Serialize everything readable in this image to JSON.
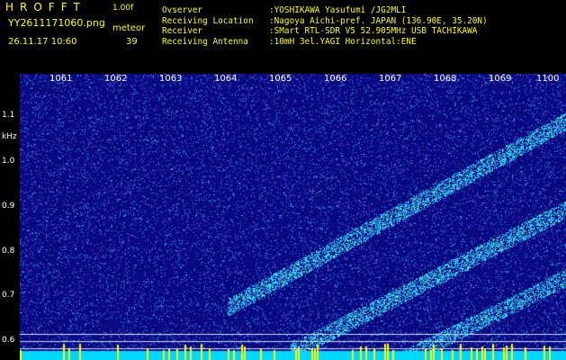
{
  "header": {
    "app_name": "HROFFT",
    "version": "1.00f",
    "filename": "YY2611171060.png",
    "datetime": "26.11.17 10:60",
    "meteor_label": "meteor",
    "meteor_count": "39"
  },
  "station": [
    {
      "key": "Ovserver",
      "value": ":YOSHIKAWA Yasufumi /JG2MLI"
    },
    {
      "key": "Receiving Location",
      "value": ":Nagoya Aichi-pref. JAPAN (136.90E, 35.20N)"
    },
    {
      "key": "Receiver",
      "value": ":SMart RTL-SDR V5 52.905MHz USB TACHIKAWA"
    },
    {
      "key": "Receiving Antenna",
      "value": ":10mH 3el.YAGI Horizontal:ENE"
    }
  ],
  "axes": {
    "y_unit": "kHz",
    "y_ticks": [
      "1.1",
      "1.0",
      "0.9",
      "0.8",
      "0.7",
      "0.6"
    ],
    "x_ticks": [
      "1061",
      "1062",
      "1063",
      "1064",
      "1065",
      "1066",
      "1067",
      "1068",
      "1069",
      "1100"
    ]
  },
  "colors": {
    "background": "#000000",
    "text_yellow": "#ffff00",
    "text_green": "#00ff66",
    "spectrogram_base": "#0a0a8c",
    "noise_floor": "#00d8ff"
  }
}
